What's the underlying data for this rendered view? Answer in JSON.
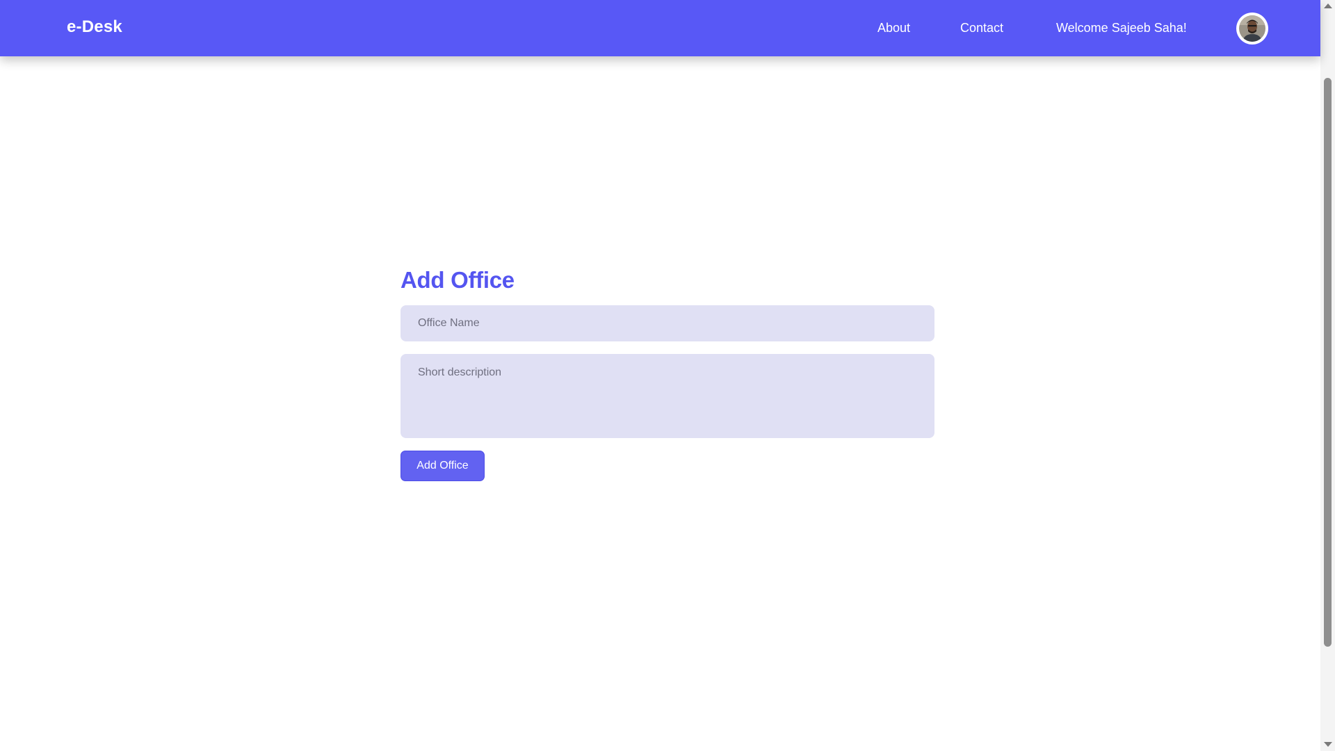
{
  "navbar": {
    "brand": "e-Desk",
    "links": {
      "about": "About",
      "contact": "Contact",
      "welcome": "Welcome Sajeeb Saha!"
    },
    "avatar_icon": "user-avatar",
    "background_color": "#5858f6"
  },
  "form": {
    "title": "Add Office",
    "office_name_placeholder": "Office Name",
    "office_name_value": "",
    "description_placeholder": "Short description",
    "description_value": "",
    "submit_label": "Add Office",
    "accent_color": "#5455f0",
    "field_background": "#e0e0f4"
  }
}
